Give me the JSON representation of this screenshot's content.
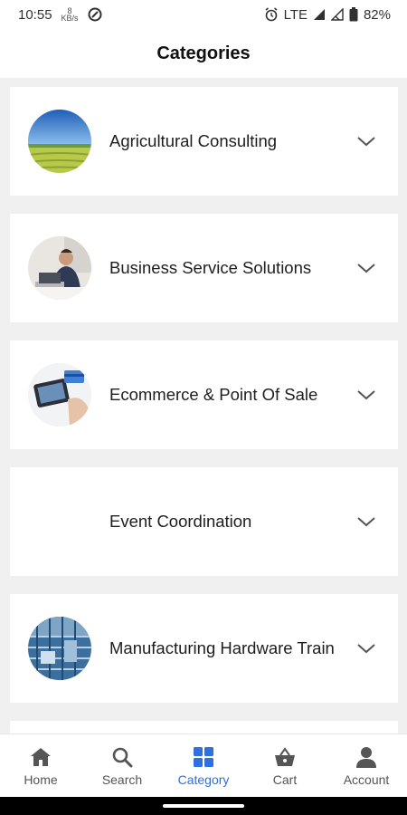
{
  "status_bar": {
    "time": "10:55",
    "data_rate_value": "8",
    "data_rate_unit": "KB/s",
    "network": "LTE",
    "battery": "82%"
  },
  "header": {
    "title": "Categories"
  },
  "categories": [
    {
      "label": "Agricultural Consulting",
      "icon": "field-photo"
    },
    {
      "label": "Business Service Solutions",
      "icon": "businessman-photo"
    },
    {
      "label": "Ecommerce & Point Of Sale",
      "icon": "card-terminal-photo"
    },
    {
      "label": "Event Coordination",
      "icon": ""
    },
    {
      "label": "Manufacturing Hardware Train",
      "icon": "factory-photo"
    }
  ],
  "bottom_nav": {
    "items": [
      {
        "label": "Home",
        "icon": "home-icon",
        "active": false
      },
      {
        "label": "Search",
        "icon": "search-icon",
        "active": false
      },
      {
        "label": "Category",
        "icon": "grid-icon",
        "active": true
      },
      {
        "label": "Cart",
        "icon": "basket-icon",
        "active": false
      },
      {
        "label": "Account",
        "icon": "person-icon",
        "active": false
      }
    ]
  },
  "colors": {
    "accent": "#2f6fe0",
    "inactive": "#555555",
    "background": "#f0f0f0",
    "card": "#ffffff"
  }
}
